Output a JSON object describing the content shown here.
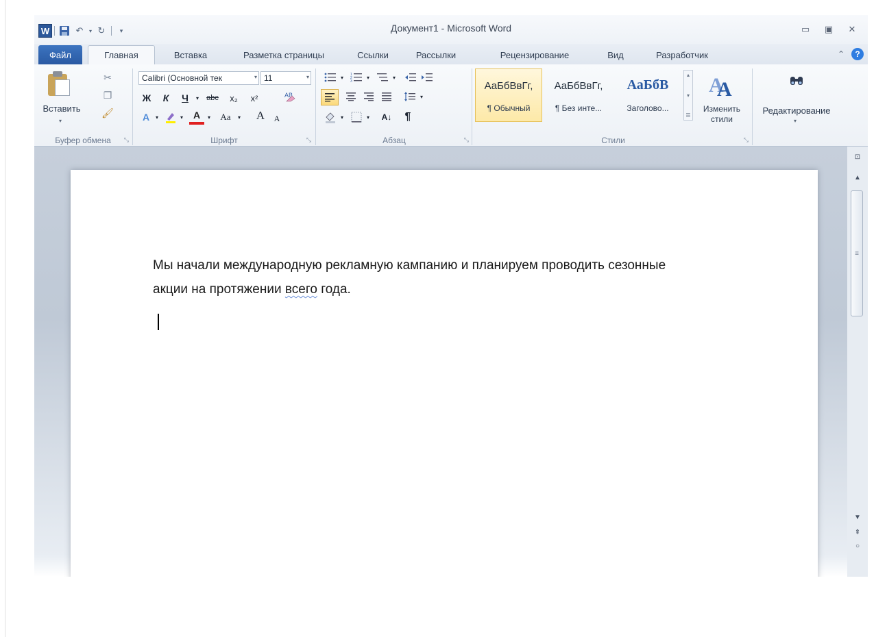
{
  "window": {
    "title": "Документ1 - Microsoft Word",
    "app_logo": "W",
    "qat": {
      "save_icon": "save-icon",
      "undo_icon": "undo-icon",
      "redo_icon": "redo-icon",
      "customize_icon": "chevron-down-icon"
    },
    "controls": {
      "minimize": "▭",
      "maximize": "▣",
      "close": "✕"
    }
  },
  "tabs": {
    "file": "Файл",
    "home": "Главная",
    "insert": "Вставка",
    "page_layout": "Разметка страницы",
    "references": "Ссылки",
    "mailings": "Рассылки",
    "review": "Рецензирование",
    "view": "Вид",
    "developer": "Разработчик",
    "minimize_ribbon": "⌃",
    "help": "?"
  },
  "ribbon": {
    "clipboard": {
      "label": "Буфер обмена",
      "paste": "Вставить",
      "launcher": "⤡"
    },
    "font": {
      "label": "Шрифт",
      "font_name": "Calibri (Основной тек",
      "font_size": "11",
      "bold": "Ж",
      "italic": "К",
      "underline": "Ч",
      "strike": "abc",
      "subscript": "x₂",
      "superscript": "x²",
      "case": "Aa",
      "grow": "A",
      "shrink": "A",
      "launcher": "⤡"
    },
    "paragraph": {
      "label": "Абзац",
      "sort": "А↓",
      "pilcrow": "¶",
      "launcher": "⤡"
    },
    "styles": {
      "label": "Стили",
      "items": [
        {
          "sample": "АаБбВвГг,",
          "name": "¶ Обычный"
        },
        {
          "sample": "АаБбВвГг,",
          "name": "¶ Без инте..."
        },
        {
          "sample": "АаБбВ",
          "name": "Заголово..."
        }
      ],
      "change_styles": "Изменить стили",
      "launcher": "⤡"
    },
    "editing": {
      "label": "Редактирование"
    }
  },
  "document": {
    "line1": "Мы начали международную рекламную кампанию и планируем проводить сезонные",
    "line2_before": "акции на протяжении ",
    "line2_squiggle": "всего",
    "line2_after": " года."
  },
  "colors": {
    "file_tab": "#2a5aa3",
    "accent": "#2b579a",
    "selected_style": "#fde9a8"
  }
}
